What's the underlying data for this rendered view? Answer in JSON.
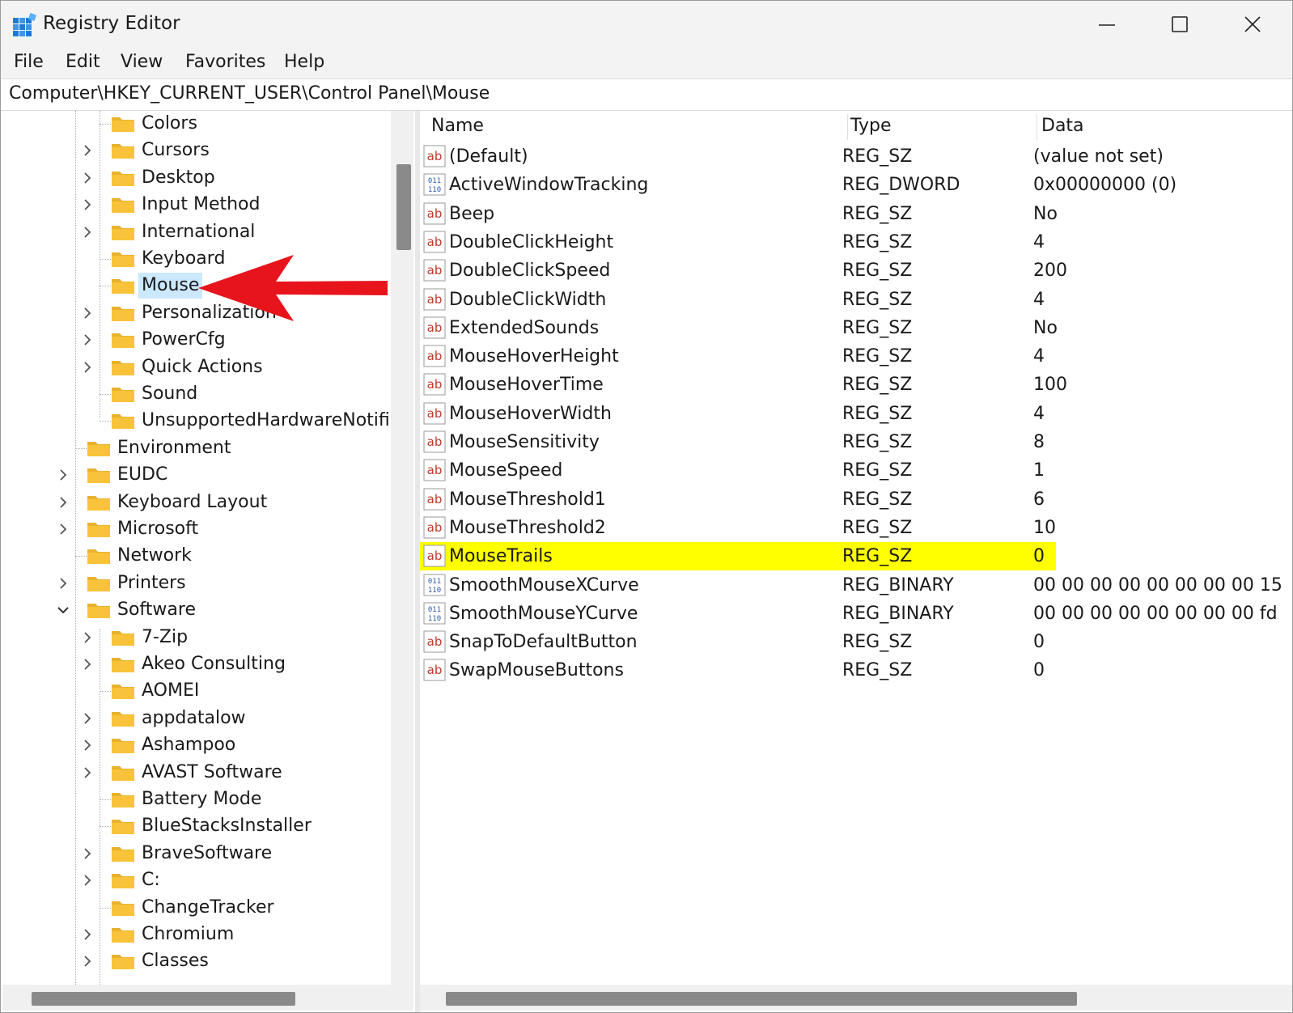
{
  "window": {
    "title": "Registry Editor"
  },
  "menu": [
    "File",
    "Edit",
    "View",
    "Favorites",
    "Help"
  ],
  "address": "Computer\\HKEY_CURRENT_USER\\Control Panel\\Mouse",
  "tree": [
    {
      "label": "Colors",
      "indent": 2,
      "expander": "none"
    },
    {
      "label": "Cursors",
      "indent": 2,
      "expander": "collapsed"
    },
    {
      "label": "Desktop",
      "indent": 2,
      "expander": "collapsed"
    },
    {
      "label": "Input Method",
      "indent": 2,
      "expander": "collapsed"
    },
    {
      "label": "International",
      "indent": 2,
      "expander": "collapsed"
    },
    {
      "label": "Keyboard",
      "indent": 2,
      "expander": "none"
    },
    {
      "label": "Mouse",
      "indent": 2,
      "expander": "none",
      "selected": true
    },
    {
      "label": "Personalization",
      "indent": 2,
      "expander": "collapsed"
    },
    {
      "label": "PowerCfg",
      "indent": 2,
      "expander": "collapsed"
    },
    {
      "label": "Quick Actions",
      "indent": 2,
      "expander": "collapsed"
    },
    {
      "label": "Sound",
      "indent": 2,
      "expander": "none"
    },
    {
      "label": "UnsupportedHardwareNotificationCache",
      "indent": 2,
      "expander": "none"
    },
    {
      "label": "Environment",
      "indent": 1,
      "expander": "none"
    },
    {
      "label": "EUDC",
      "indent": 1,
      "expander": "collapsed"
    },
    {
      "label": "Keyboard Layout",
      "indent": 1,
      "expander": "collapsed"
    },
    {
      "label": "Microsoft",
      "indent": 1,
      "expander": "collapsed"
    },
    {
      "label": "Network",
      "indent": 1,
      "expander": "none"
    },
    {
      "label": "Printers",
      "indent": 1,
      "expander": "collapsed"
    },
    {
      "label": "Software",
      "indent": 1,
      "expander": "expanded"
    },
    {
      "label": "7-Zip",
      "indent": 2,
      "expander": "collapsed"
    },
    {
      "label": "Akeo Consulting",
      "indent": 2,
      "expander": "collapsed"
    },
    {
      "label": "AOMEI",
      "indent": 2,
      "expander": "none"
    },
    {
      "label": "appdatalow",
      "indent": 2,
      "expander": "collapsed"
    },
    {
      "label": "Ashampoo",
      "indent": 2,
      "expander": "collapsed"
    },
    {
      "label": "AVAST Software",
      "indent": 2,
      "expander": "collapsed"
    },
    {
      "label": "Battery Mode",
      "indent": 2,
      "expander": "none"
    },
    {
      "label": "BlueStacksInstaller",
      "indent": 2,
      "expander": "none"
    },
    {
      "label": "BraveSoftware",
      "indent": 2,
      "expander": "collapsed"
    },
    {
      "label": "C:",
      "indent": 2,
      "expander": "collapsed"
    },
    {
      "label": "ChangeTracker",
      "indent": 2,
      "expander": "none"
    },
    {
      "label": "Chromium",
      "indent": 2,
      "expander": "collapsed"
    },
    {
      "label": "Classes",
      "indent": 2,
      "expander": "collapsed"
    }
  ],
  "columns": {
    "name": "Name",
    "type": "Type",
    "data": "Data"
  },
  "values": [
    {
      "name": "(Default)",
      "type": "REG_SZ",
      "data": "(value not set)",
      "icon": "string-value-icon"
    },
    {
      "name": "ActiveWindowTracking",
      "type": "REG_DWORD",
      "data": "0x00000000 (0)",
      "icon": "binary-value-icon"
    },
    {
      "name": "Beep",
      "type": "REG_SZ",
      "data": "No",
      "icon": "string-value-icon"
    },
    {
      "name": "DoubleClickHeight",
      "type": "REG_SZ",
      "data": "4",
      "icon": "string-value-icon"
    },
    {
      "name": "DoubleClickSpeed",
      "type": "REG_SZ",
      "data": "200",
      "icon": "string-value-icon"
    },
    {
      "name": "DoubleClickWidth",
      "type": "REG_SZ",
      "data": "4",
      "icon": "string-value-icon"
    },
    {
      "name": "ExtendedSounds",
      "type": "REG_SZ",
      "data": "No",
      "icon": "string-value-icon"
    },
    {
      "name": "MouseHoverHeight",
      "type": "REG_SZ",
      "data": "4",
      "icon": "string-value-icon"
    },
    {
      "name": "MouseHoverTime",
      "type": "REG_SZ",
      "data": "100",
      "icon": "string-value-icon"
    },
    {
      "name": "MouseHoverWidth",
      "type": "REG_SZ",
      "data": "4",
      "icon": "string-value-icon"
    },
    {
      "name": "MouseSensitivity",
      "type": "REG_SZ",
      "data": "8",
      "icon": "string-value-icon"
    },
    {
      "name": "MouseSpeed",
      "type": "REG_SZ",
      "data": "1",
      "icon": "string-value-icon"
    },
    {
      "name": "MouseThreshold1",
      "type": "REG_SZ",
      "data": "6",
      "icon": "string-value-icon"
    },
    {
      "name": "MouseThreshold2",
      "type": "REG_SZ",
      "data": "10",
      "icon": "string-value-icon"
    },
    {
      "name": "MouseTrails",
      "type": "REG_SZ",
      "data": "0",
      "icon": "string-value-icon",
      "highlighted": true
    },
    {
      "name": "SmoothMouseXCurve",
      "type": "REG_BINARY",
      "data": "00 00 00 00 00 00 00 00 15",
      "icon": "binary-value-icon"
    },
    {
      "name": "SmoothMouseYCurve",
      "type": "REG_BINARY",
      "data": "00 00 00 00 00 00 00 00 fd",
      "icon": "binary-value-icon"
    },
    {
      "name": "SnapToDefaultButton",
      "type": "REG_SZ",
      "data": "0",
      "icon": "string-value-icon"
    },
    {
      "name": "SwapMouseButtons",
      "type": "REG_SZ",
      "data": "0",
      "icon": "string-value-icon"
    }
  ],
  "colors": {
    "selection": "#cce8ff",
    "highlight": "#ffff00",
    "arrow": "#e8141c",
    "folder": "#f8c33a"
  }
}
